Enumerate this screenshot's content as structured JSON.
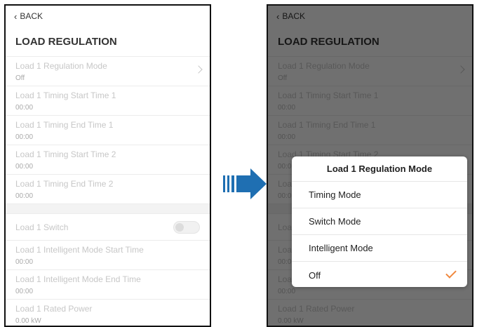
{
  "back_label": "BACK",
  "page_title": "LOAD REGULATION",
  "settings": [
    {
      "label": "Load 1 Regulation Mode",
      "value": "Off"
    },
    {
      "label": "Load 1 Timing Start Time 1",
      "value": "00:00"
    },
    {
      "label": "Load 1 Timing End Time 1",
      "value": "00:00"
    },
    {
      "label": "Load 1 Timing Start Time 2",
      "value": "00:00"
    },
    {
      "label": "Load 1 Timing End Time 2",
      "value": "00:00"
    }
  ],
  "switch_label": "Load 1 Switch",
  "settings2": [
    {
      "label": "Load 1 Intelligent Mode Start Time",
      "value": "00:00"
    },
    {
      "label": "Load 1 Intelligent Mode End Time",
      "value": "00:00"
    },
    {
      "label": "Load 1 Rated Power",
      "value": "0.00 kW"
    }
  ],
  "dialog": {
    "title": "Load 1 Regulation Mode",
    "options": [
      "Timing Mode",
      "Switch Mode",
      "Intelligent Mode",
      "Off"
    ],
    "selected": "Off"
  },
  "colors": {
    "accent": "#f0883e",
    "arrow": "#1f6fb2"
  }
}
